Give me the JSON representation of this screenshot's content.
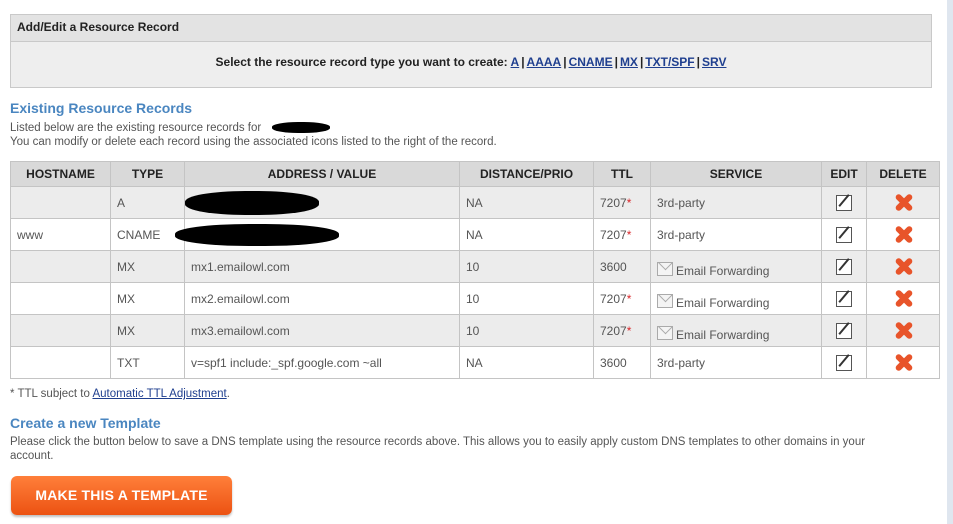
{
  "panel": {
    "title": "Add/Edit a Resource Record",
    "prompt": "Select the resource record type you want to create:",
    "types": [
      "A",
      "AAAA",
      "CNAME",
      "MX",
      "TXT/SPF",
      "SRV"
    ]
  },
  "existing": {
    "title": "Existing Resource Records",
    "line1": "Listed below are the existing resource records for",
    "line2": "You can modify or delete each record using the associated icons listed to the right of the record."
  },
  "table": {
    "headers": [
      "HOSTNAME",
      "TYPE",
      "ADDRESS / VALUE",
      "DISTANCE/PRIO",
      "TTL",
      "SERVICE",
      "EDIT",
      "DELETE"
    ],
    "rows": [
      {
        "hostname": "",
        "type": "A",
        "value": "",
        "prio": "NA",
        "ttl": "7207",
        "ttl_mark": "*",
        "service": "3rd-party",
        "service_icon": ""
      },
      {
        "hostname": "www",
        "type": "CNAME",
        "value": "",
        "prio": "NA",
        "ttl": "7207",
        "ttl_mark": "*",
        "service": "3rd-party",
        "service_icon": ""
      },
      {
        "hostname": "",
        "type": "MX",
        "value": "mx1.emailowl.com",
        "prio": "10",
        "ttl": "3600",
        "ttl_mark": "",
        "service": "Email Forwarding",
        "service_icon": "mail-icon"
      },
      {
        "hostname": "",
        "type": "MX",
        "value": "mx2.emailowl.com",
        "prio": "10",
        "ttl": "7207",
        "ttl_mark": "*",
        "service": "Email Forwarding",
        "service_icon": "mail-icon"
      },
      {
        "hostname": "",
        "type": "MX",
        "value": "mx3.emailowl.com",
        "prio": "10",
        "ttl": "7207",
        "ttl_mark": "*",
        "service": "Email Forwarding",
        "service_icon": "mail-icon"
      },
      {
        "hostname": "",
        "type": "TXT",
        "value": "v=spf1 include:_spf.google.com ~all",
        "prio": "NA",
        "ttl": "3600",
        "ttl_mark": "",
        "service": "3rd-party",
        "service_icon": ""
      }
    ]
  },
  "note": {
    "prefix": "* TTL subject to ",
    "link": "Automatic TTL Adjustment",
    "suffix": "."
  },
  "template": {
    "title": "Create a new Template",
    "desc_line1": "Please click the button below to save a DNS template using the resource records above. This allows you to easily apply custom DNS templates to other domains in your",
    "desc_line2": "account.",
    "button": "MAKE THIS A TEMPLATE"
  },
  "colors": {
    "heading": "#4a86c0",
    "link": "#1f3f8f",
    "asterisk": "#d9262a",
    "delete": "#e8542a",
    "button": "#f0601c"
  }
}
